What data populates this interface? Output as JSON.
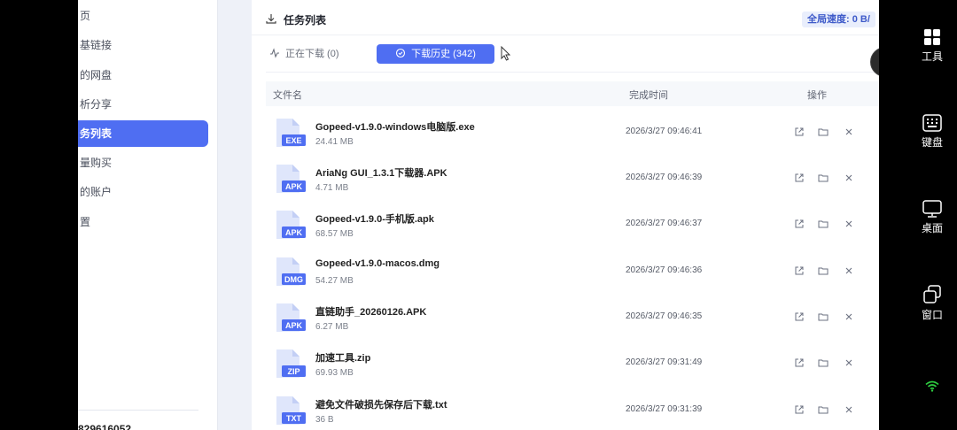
{
  "sidebar": {
    "items": [
      {
        "label": "页"
      },
      {
        "label": "基链接"
      },
      {
        "label": "的网盘"
      },
      {
        "label": "析分享"
      },
      {
        "label": "务列表",
        "active": true
      },
      {
        "label": "量购买"
      },
      {
        "label": "的账户"
      },
      {
        "label": "置"
      }
    ],
    "footer_text": "829616052"
  },
  "header": {
    "title": "任务列表",
    "speed": "全局速度: 0 B/"
  },
  "tabs": {
    "downloading": "正在下载 (0)",
    "history": "下载历史 (342)"
  },
  "table": {
    "columns": {
      "name": "文件名",
      "time": "完成时间",
      "actions": "操作"
    },
    "rows": [
      {
        "ext": "EXE",
        "name": "Gopeed-v1.9.0-windows电脑版.exe",
        "size": "24.41 MB",
        "time": "2026/3/27 09:46:41"
      },
      {
        "ext": "APK",
        "name": "AriaNg GUI_1.3.1下载器.APK",
        "size": "4.71 MB",
        "time": "2026/3/27 09:46:39"
      },
      {
        "ext": "APK",
        "name": "Gopeed-v1.9.0-手机版.apk",
        "size": "68.57 MB",
        "time": "2026/3/27 09:46:37"
      },
      {
        "ext": "DMG",
        "name": "Gopeed-v1.9.0-macos.dmg",
        "size": "54.27 MB",
        "time": "2026/3/27 09:46:36"
      },
      {
        "ext": "APK",
        "name": "直链助手_20260126.APK",
        "size": "6.27 MB",
        "time": "2026/3/27 09:46:35"
      },
      {
        "ext": "ZIP",
        "name": "加速工具.zip",
        "size": "69.93 MB",
        "time": "2026/3/27 09:31:49"
      },
      {
        "ext": "TXT",
        "name": "避免文件破损先保存后下载.txt",
        "size": "36 B",
        "time": "2026/3/27 09:31:39"
      }
    ]
  },
  "right_toolbar": {
    "tools": "工具",
    "keyboard": "键盘",
    "desktop": "桌面",
    "window": "窗口"
  },
  "icons": {
    "header": "download-icon",
    "downloading_tab": "activity-icon",
    "history_tab": "check-circle-icon",
    "row_actions": [
      "open-external-icon",
      "folder-icon",
      "close-icon"
    ],
    "wifi": "wifi-icon"
  },
  "colors": {
    "accent": "#4f6ef2",
    "file_icon": "#4f6ef2",
    "wifi": "#2ecc40"
  }
}
